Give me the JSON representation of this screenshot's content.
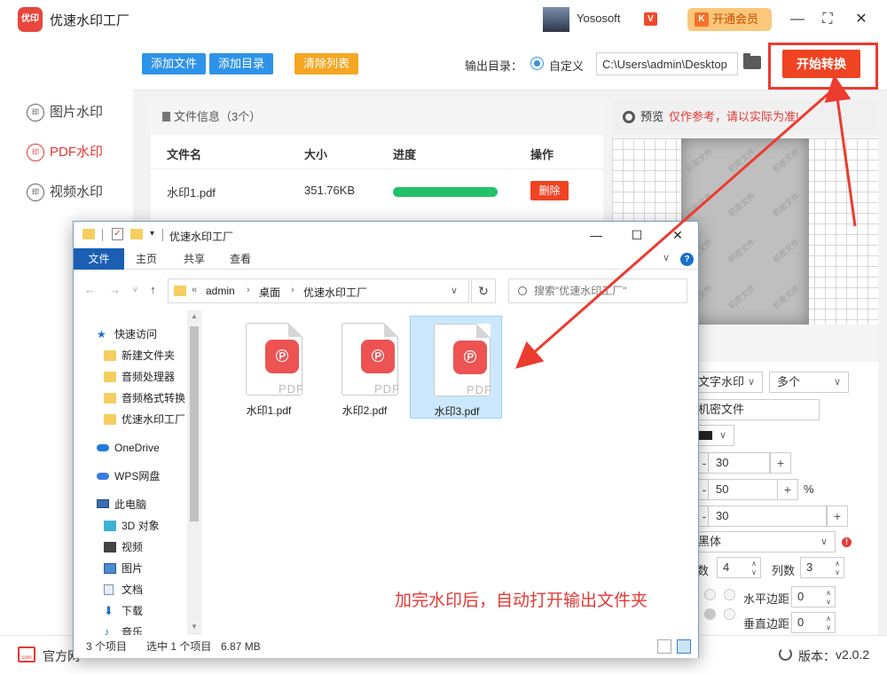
{
  "app": {
    "logo_text": "优印",
    "title": "优速水印工厂",
    "user_name": "Yososoft",
    "vip_mark": "V",
    "vip_button": "开通会员",
    "vip_k": "K"
  },
  "window_controls": {
    "minimize": "—",
    "maximize": "⛶",
    "close": "✕"
  },
  "sidebar": {
    "items": [
      {
        "label": "图片水印",
        "icon": "image-watermark-icon",
        "active": false
      },
      {
        "label": "PDF水印",
        "icon": "pdf-watermark-icon",
        "active": true
      },
      {
        "label": "视频水印",
        "icon": "video-watermark-icon",
        "active": false
      }
    ],
    "icon_glyph": "印"
  },
  "toolbar": {
    "add_file": "添加文件",
    "add_folder": "添加目录",
    "clear_list": "清除列表",
    "output_label": "输出目录：",
    "output_option": "自定义",
    "output_path": "C:\\Users\\admin\\Desktop",
    "start_button": "开始转换"
  },
  "file_panel": {
    "header": "文件信息（3个）",
    "columns": {
      "name": "文件名",
      "size": "大小",
      "progress": "进度",
      "action": "操作"
    },
    "rows": [
      {
        "name": "水印1.pdf",
        "size": "351.76KB",
        "progress": 1.0,
        "action": "删除"
      }
    ]
  },
  "preview": {
    "label": "预览",
    "warning": "仅作参考，请以实际为准!",
    "watermark_text": "机密文件"
  },
  "settings": {
    "watermark_type": "文字水印",
    "layout": "多个",
    "text_value": "机密文件",
    "value1": "30",
    "value2": "50",
    "percent": "%",
    "value3": "30",
    "font": "黑体",
    "rows_label": "数",
    "rows_value": "4",
    "cols_label": "列数",
    "cols_value": "3",
    "h_margin_label": "水平边距",
    "h_margin_value": "0",
    "v_margin_label": "垂直边距",
    "v_margin_value": "0"
  },
  "bottombar": {
    "official_site": "官方网",
    "version_label": "版本：",
    "version": "v2.0.2"
  },
  "explorer": {
    "title": "优速水印工厂",
    "ribbon_tabs": [
      "文件",
      "主页",
      "共享",
      "查看"
    ],
    "breadcrumb": [
      "admin",
      "桌面",
      "优速水印工厂"
    ],
    "crumb_prefix": "«",
    "search_placeholder": "搜索\"优速水印工厂\"",
    "nav": {
      "quick_access": "快速访问",
      "quick_items": [
        "新建文件夹",
        "音频处理器",
        "音频格式转换",
        "优速水印工厂"
      ],
      "onedrive": "OneDrive",
      "wps": "WPS网盘",
      "this_pc": "此电脑",
      "pc_items": [
        "3D 对象",
        "视频",
        "图片",
        "文档",
        "下载",
        "音乐"
      ]
    },
    "files": [
      {
        "name": "水印1.pdf",
        "selected": false
      },
      {
        "name": "水印2.pdf",
        "selected": false
      },
      {
        "name": "水印3.pdf",
        "selected": true
      }
    ],
    "pdf_label": "PDF",
    "status": {
      "count": "3 个项目",
      "selected": "选中 1 个项目",
      "size": "6.87 MB"
    }
  },
  "annotation": "加完水印后，自动打开输出文件夹",
  "colors": {
    "accent_red": "#ef4322",
    "button_blue": "#2e93e8",
    "button_orange": "#f5a623",
    "progress_green": "#22c16a"
  }
}
